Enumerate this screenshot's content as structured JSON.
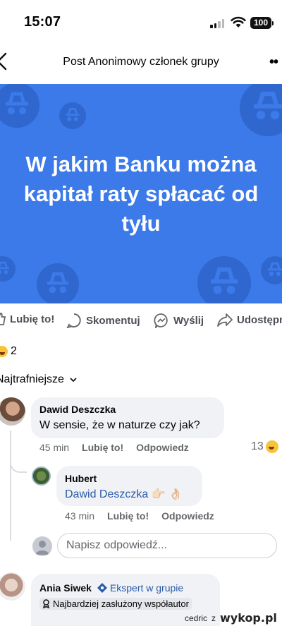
{
  "status_bar": {
    "time": "15:07",
    "battery": "100"
  },
  "header": {
    "title": "Post Anonimowy członek grupy"
  },
  "banner": {
    "text_line1": "W jakim Banku  można",
    "text_line2": "kapitał raty spłacać od",
    "text_line3": "tyłu",
    "color": "#3b7ae8"
  },
  "actions": {
    "like": "Lubię to!",
    "comment": "Skomentuj",
    "send": "Wyślij",
    "share": "Udostępnij"
  },
  "reactions": {
    "count": "2"
  },
  "sort": {
    "label": "Najtrafniejsze"
  },
  "comments": [
    {
      "author": "Dawid Deszczka",
      "text": "W sensie, że w naturze czy jak?",
      "time": "45 min",
      "like": "Lubię to!",
      "reply": "Odpowiedz",
      "reaction_count": "13"
    },
    {
      "author": "Hubert",
      "mention": "Dawid Deszczka",
      "text_emoji": "👉🏻 👌🏻",
      "time": "43 min",
      "like": "Lubię to!",
      "reply": "Odpowiedz"
    }
  ],
  "reply_input": {
    "placeholder": "Napisz odpowiedź..."
  },
  "third_comment": {
    "author": "Ania Siwek",
    "expert_label": "Ekspert w grupie",
    "badge": "Najbardziej zasłużony współautor"
  },
  "watermark": {
    "user": "cedric",
    "z": "z",
    "site": "wykop.pl"
  }
}
